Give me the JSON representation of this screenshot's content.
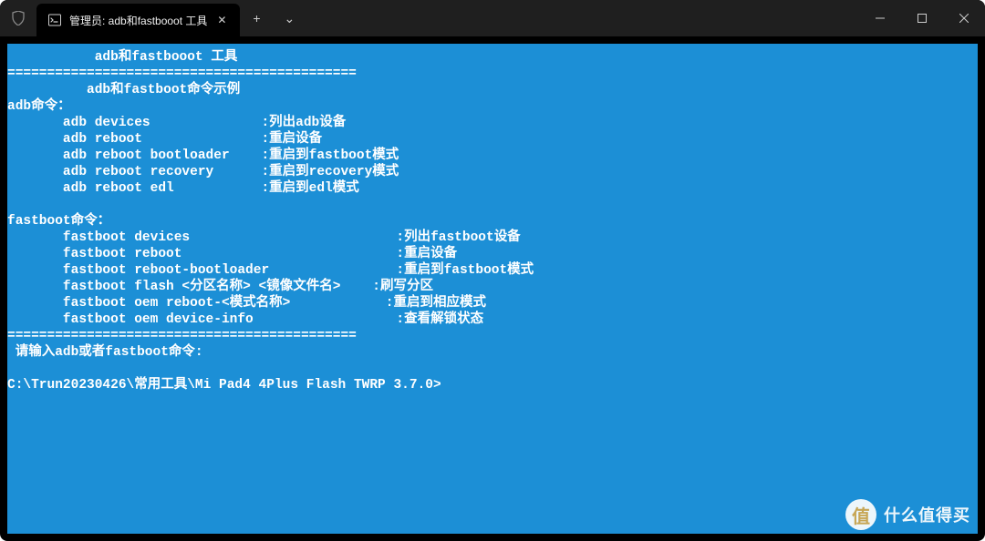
{
  "titlebar": {
    "tab_title": "管理员: adb和fastbooot 工具",
    "close_glyph": "✕",
    "new_tab_glyph": "+",
    "dropdown_glyph": "⌄",
    "minimize_glyph": "—",
    "maximize_glyph": "□",
    "window_close_glyph": "✕"
  },
  "terminal": {
    "indent_title": "           adb和fastbooot 工具",
    "dash_line1": "============================================",
    "indent_subtitle": "          adb和fastboot命令示例",
    "adb_header": "adb命令：",
    "adb_rows": [
      {
        "cmd": "       adb devices              ",
        "desc": ":列出adb设备"
      },
      {
        "cmd": "       adb reboot               ",
        "desc": ":重启设备"
      },
      {
        "cmd": "       adb reboot bootloader    ",
        "desc": ":重启到fastboot模式"
      },
      {
        "cmd": "       adb reboot recovery      ",
        "desc": ":重启到recovery模式"
      },
      {
        "cmd": "       adb reboot edl           ",
        "desc": ":重启到edl模式"
      }
    ],
    "blank": "",
    "fastboot_header": "fastboot命令：",
    "fb_rows": [
      {
        "cmd": "       fastboot devices                          ",
        "desc": ":列出fastboot设备"
      },
      {
        "cmd": "       fastboot reboot                           ",
        "desc": ":重启设备"
      },
      {
        "cmd": "       fastboot reboot-bootloader                ",
        "desc": ":重启到fastboot模式"
      },
      {
        "cmd": "       fastboot flash <分区名称> <镜像文件名>    ",
        "desc": ":刷写分区"
      },
      {
        "cmd": "       fastboot oem reboot-<模式名称>            ",
        "desc": ":重启到相应模式"
      },
      {
        "cmd": "       fastboot oem device-info                  ",
        "desc": ":查看解锁状态"
      }
    ],
    "dash_line2": "============================================",
    "prompt_hint": " 请输入adb或者fastboot命令:",
    "cwd_prompt": "C:\\Trun20230426\\常用工具\\Mi Pad4 4Plus Flash TWRP 3.7.0>"
  },
  "watermark": {
    "badge": "值",
    "text": "什么值得买"
  }
}
